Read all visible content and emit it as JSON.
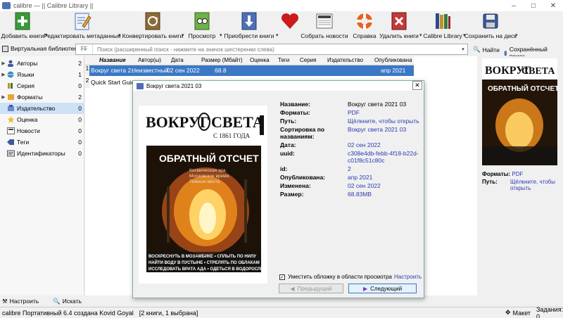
{
  "window": {
    "title": "calibre — || Calibre Library ||"
  },
  "toolbar": {
    "add": "Добавить книги",
    "edit_meta": "Редактировать метаданные",
    "convert": "Конвертировать книги",
    "view": "Просмотр",
    "get_books": "Приобрести книги",
    "fetch_news": "Собрать новости",
    "help": "Справка",
    "remove": "Удалить книги",
    "library": "Calibre Library",
    "save": "Сохранить на диск"
  },
  "search": {
    "virtual_library": "Виртуальная библиотека",
    "placeholder": "Поиск (расширенный поиск - нажмите на значок шестеренки слева)",
    "find": "Найти",
    "saved": "Сохранённый поиск"
  },
  "tag_browser": {
    "items": [
      {
        "label": "Авторы",
        "count": "2",
        "expand": true
      },
      {
        "label": "Языки",
        "count": "1",
        "expand": true
      },
      {
        "label": "Серия",
        "count": "0",
        "expand": false
      },
      {
        "label": "Форматы",
        "count": "2",
        "expand": true
      },
      {
        "label": "Издательство",
        "count": "0",
        "expand": false
      },
      {
        "label": "Оценка",
        "count": "0",
        "expand": false
      },
      {
        "label": "Новости",
        "count": "0",
        "expand": false
      },
      {
        "label": "Теги",
        "count": "0",
        "expand": false
      },
      {
        "label": "Идентификаторы",
        "count": "0",
        "expand": false
      }
    ],
    "configure": "Настроить",
    "find": "Искать"
  },
  "book_list": {
    "columns": [
      "Название",
      "Автор(ы)",
      "Дата",
      "Размер (Мбайт)",
      "Оценка",
      "Теги",
      "Серия",
      "Издательство",
      "Опубликована"
    ],
    "rows": [
      {
        "num": "1",
        "title": "Вокруг света 2...",
        "author": "Неизвестный",
        "date": "02 сен 2022",
        "size": "68.8",
        "published": "апр 2021"
      },
      {
        "num": "2",
        "title": "Quick Start Guide",
        "author": "",
        "date": "",
        "size": "",
        "published": ""
      }
    ]
  },
  "book_details_panel": {
    "formats_label": "Форматы:",
    "formats_value": "PDF",
    "path_label": "Путь:",
    "path_value": "Щёлкните, чтобы открыть"
  },
  "dialog": {
    "title": "Вокруг света 2021 03",
    "fields": [
      {
        "label": "Название:",
        "value": "Вокруг света 2021 03"
      },
      {
        "label": "Форматы:",
        "value": "PDF"
      },
      {
        "label": "Путь:",
        "value": "Щёлкните, чтобы открыть"
      },
      {
        "label": "Сортировка по названиям:",
        "value": "Вокруг света 2021 03"
      },
      {
        "label": "Дата:",
        "value": "02 сен 2022"
      },
      {
        "label": "uuid:",
        "value": "c308e4db-febb-4f18-b22d-c01f8c51c80c"
      },
      {
        "label": "id:",
        "value": "2"
      },
      {
        "label": "Опубликована:",
        "value": "апр 2021"
      },
      {
        "label": "Изменена:",
        "value": "02 сен 2022"
      },
      {
        "label": "Размер:",
        "value": "68.83MB"
      }
    ],
    "fit_cover": "Уместить обложку в области просмотра",
    "settings": "Настроить",
    "prev": "Предыдущий",
    "next": "Следующий"
  },
  "cover": {
    "masthead_left": "ВОКРУГ",
    "masthead_right": "СВЕТА",
    "since": "С 1861 ГОДА",
    "headline": "ОБРАТНЫЙ ОТСЧЕТ",
    "sub1": "Космическая эра.",
    "sub2": "Московское время.",
    "sub3": "Темные места",
    "band1": "ВОСКРЕСНУТЬ В МОЗАМБИКЕ • СПЛЫТЬ ПО НИЛУ",
    "band2": "НАЙТИ ВОДУ В ПУСТЫНЕ • СТРЕЛЯТЬ ПО ОБЛАКАМ",
    "band3": "ИССЛЕДОВАТЬ ВРАТА АДА • ОДЕТЬСЯ В ВОДОРОСЛИ"
  },
  "status": {
    "left": "calibre Портативный 6.4 создана Kovid Goyal",
    "books": "[2 книги, 1 выбрана]",
    "layout": "Макет",
    "jobs": "Задания: 0"
  },
  "colors": {
    "accent": "#3a78c5",
    "link": "#2b3cb0",
    "heart": "#cc1b1b"
  }
}
